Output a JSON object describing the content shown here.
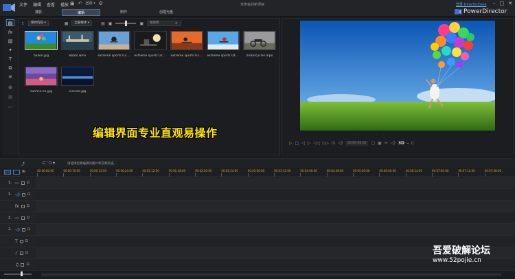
{
  "window": {
    "title": "未命名的新项目",
    "menus": [
      "文件",
      "编辑",
      "查看",
      "播放"
    ],
    "director_zone_link": "登录 DirectorZone",
    "brand": "PowerDirector",
    "redo_label": "回退 ▾"
  },
  "mode_tabs": [
    {
      "label": "捕获",
      "active": false
    },
    {
      "label": "编辑",
      "active": true
    },
    {
      "label": "制作",
      "active": false
    },
    {
      "label": "创建光盘",
      "active": false
    }
  ],
  "library": {
    "sort_select": "媒体内容",
    "filter_select": "全部媒体",
    "search_placeholder": "搜索库",
    "items": [
      {
        "caption": "ballon.jpg",
        "selected": true
      },
      {
        "caption": "Boats.wmv",
        "selected": false
      },
      {
        "caption": "extreme sports 01....",
        "selected": false
      },
      {
        "caption": "extreme sports 02....",
        "selected": false
      },
      {
        "caption": "extreme sports 03....",
        "selected": false
      },
      {
        "caption": "extreme sports 04....",
        "selected": false
      },
      {
        "caption": "motorcycles.mpo",
        "selected": false
      },
      {
        "caption": "sunrise 01.jpg",
        "selected": false
      },
      {
        "caption": "sunrise.jpg",
        "selected": false
      }
    ]
  },
  "overlay_caption": "编辑界面专业直观易操作",
  "preview": {
    "timecode": "00:00:00:00",
    "three_d": "3D"
  },
  "timeline": {
    "hint": "请选择您要编辑的图片和音频轨道。",
    "ruler_label": "00:00:00:00",
    "ruler_ticks": [
      "00:00:00:00",
      "00:00:10:00",
      "00:00:12:00",
      "00:00:24:00",
      "00:01:12:00",
      "00:01:48:00",
      "00:02:00:00",
      "00:02:24:00",
      "00:03:00:00",
      "00:03:12:00",
      "00:04:00:00",
      "00:04:48:00",
      "00:05:00:00",
      "00:06:00:00",
      "00:06:24:00",
      "00:07:00:00",
      "00:07:12:00",
      "00:07:48:00"
    ],
    "tracks": [
      {
        "number": "1.",
        "icon": "▭",
        "kind": "video"
      },
      {
        "number": "1.",
        "icon": "◁)",
        "kind": "audio"
      },
      {
        "number": "",
        "icon": "fx",
        "kind": "effect"
      },
      {
        "number": "2.",
        "icon": "▭",
        "kind": "video"
      },
      {
        "number": "2.",
        "icon": "◁)",
        "kind": "audio"
      },
      {
        "number": "",
        "icon": "T",
        "kind": "title"
      },
      {
        "number": "",
        "icon": "♪",
        "kind": "voice"
      },
      {
        "number": "",
        "icon": "♫",
        "kind": "music"
      }
    ]
  },
  "watermark": {
    "cn": "吾爱破解论坛",
    "url": "www.52pojie.cn"
  }
}
